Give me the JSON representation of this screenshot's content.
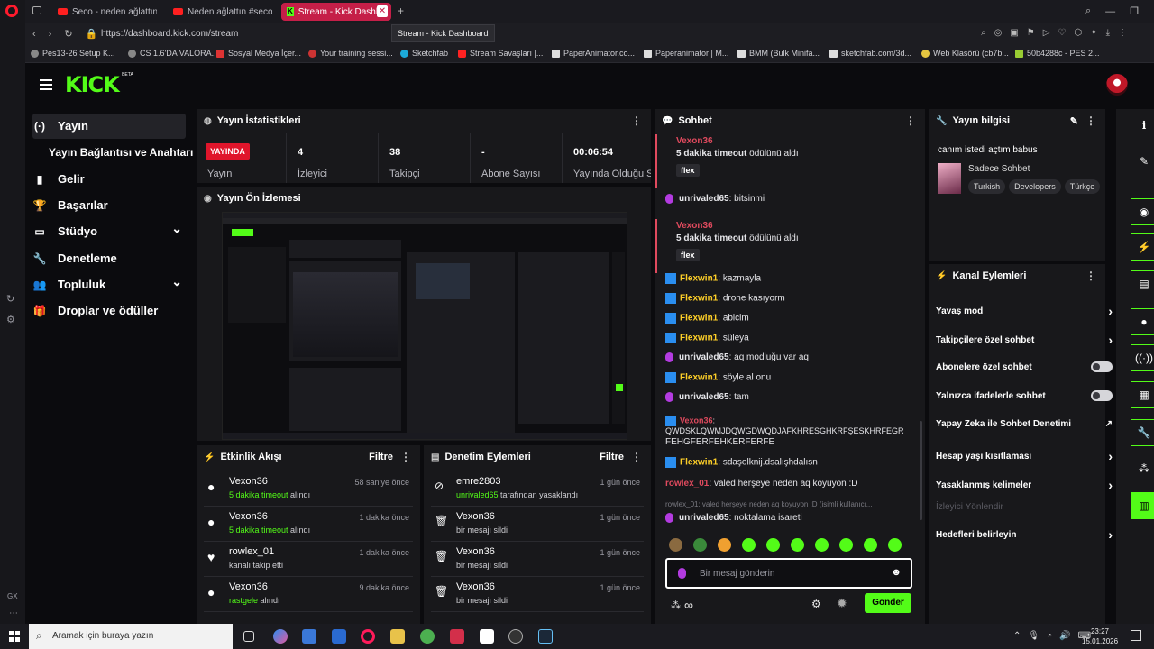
{
  "browser": {
    "tabs": [
      {
        "title": "Seco - neden ağlattın (can"
      },
      {
        "title": "Neden ağlattın #seco #tu"
      },
      {
        "title": "Stream - Kick Dashbo",
        "active": true
      }
    ],
    "url": "https://dashboard.kick.com/stream",
    "tooltip": "Stream - Kick Dashboard",
    "bookmarks": [
      "Pes13-26 Setup K...",
      "CS 1.6'DA VALORA...",
      "Sosyal Medya İçer...",
      "Your training sessi...",
      "Sketchfab",
      "Stream Savaşları |...",
      "PaperAnimator.co...",
      "Paperanimator | M...",
      "BMM (Bulk Minifa...",
      "sketchfab.com/3d...",
      "Web Klasörü (cb7b...",
      "50b4288c - PES 2..."
    ],
    "left_label": "GX"
  },
  "kick": {
    "logo": "KICK",
    "logo_beta": "BETA",
    "nav": [
      {
        "label": "Yayın",
        "icon": "(·)"
      },
      {
        "label": "Yayın Bağlantısı ve Anahtarı"
      },
      {
        "label": "Gelir",
        "icon": "▮"
      },
      {
        "label": "Başarılar",
        "icon": "🏆"
      },
      {
        "label": "Stüdyo",
        "icon": "▭",
        "chevron": "⌄"
      },
      {
        "label": "Denetleme",
        "icon": "🔧"
      },
      {
        "label": "Topluluk",
        "icon": "👥",
        "chevron": "⌄"
      },
      {
        "label": "Droplar ve ödüller",
        "icon": "🎁"
      }
    ],
    "stats": {
      "title": "Yayın İstatistikleri",
      "live_badge": "YAYINDA",
      "live_label": "Yayın",
      "items": [
        {
          "value": "4",
          "label": "İzleyici"
        },
        {
          "value": "38",
          "label": "Takipçi"
        },
        {
          "value": "-",
          "label": "Abone Sayısı"
        },
        {
          "value": "00:06:54",
          "label": "Yayında Olduğu Sü"
        }
      ]
    },
    "preview": {
      "title": "Yayın Ön İzlemesi"
    },
    "activity": {
      "title": "Etkinlik Akışı",
      "filter": "Filtre",
      "rows": [
        {
          "name": "Vexon36",
          "desc_hl": "5 dakika timeout",
          "desc": " alındı",
          "time": "58 saniye önce",
          "icon": "●"
        },
        {
          "name": "Vexon36",
          "desc_hl": "5 dakika timeout",
          "desc": " alındı",
          "time": "1 dakika önce",
          "icon": "●"
        },
        {
          "name": "rowlex_01",
          "desc_hl": "",
          "desc": "kanalı takip etti",
          "time": "1 dakika önce",
          "icon": "♥"
        },
        {
          "name": "Vexon36",
          "desc_hl": "rastgele",
          "desc": " alındı",
          "time": "9 dakika önce",
          "icon": "●"
        }
      ]
    },
    "moderation": {
      "title": "Denetim Eylemleri",
      "filter": "Filtre",
      "rows": [
        {
          "name": "emre2803",
          "desc_hl": "unrivaled65",
          "desc": " tarafından yasaklandı",
          "time": "1 gün önce",
          "icon": "⊘"
        },
        {
          "name": "Vexon36",
          "desc_hl": "",
          "desc": "bir mesajı sildi",
          "time": "1 gün önce",
          "icon": "🗑"
        },
        {
          "name": "Vexon36",
          "desc_hl": "",
          "desc": "bir mesajı sildi",
          "time": "1 gün önce",
          "icon": "🗑"
        },
        {
          "name": "Vexon36",
          "desc_hl": "",
          "desc": "bir mesajı sildi",
          "time": "1 gün önce",
          "icon": "🗑"
        }
      ]
    },
    "chat": {
      "title": "Sohbet",
      "messages": [
        {
          "user": "Vexon36",
          "text_bold": "5 dakika timeout",
          "text": " ödülünü aldı",
          "tag": "flex"
        },
        {
          "user": "unrivaled65",
          "text": "bitsinmi"
        },
        {
          "user": "Vexon36",
          "text_bold": "5 dakika timeout",
          "text": " ödülünü aldı",
          "tag": "flex"
        },
        {
          "user": "Flexwin1",
          "text": "kazmayla"
        },
        {
          "user": "Flexwin1",
          "text": "drone kasıyorm"
        },
        {
          "user": "Flexwin1",
          "text": "abicim"
        },
        {
          "user": "Flexwin1",
          "text": "süleya"
        },
        {
          "user": "unrivaled65",
          "text": "aq modluğu var aq"
        },
        {
          "user": "Flexwin1",
          "text": "söyle al onu"
        },
        {
          "user": "unrivaled65",
          "text": "tam"
        },
        {
          "user": "Vexon36",
          "text": "QWDSKLQWMJDQWGDWQDJAFKHRESGHKRFŞESKHRFEGR"
        },
        {
          "user": "",
          "text": "FEHGFERFEHKERFERFE"
        },
        {
          "user": "Flexwin1",
          "text": "sdaşolknij.dsalışhdalısn"
        },
        {
          "user": "rowlex_01",
          "text": "valed herşeye neden aq koyuyon :D"
        },
        {
          "user": "rowlex_01",
          "text": "valed herşeye neden aq koyuyon :D (isimli kullanıcı..."
        },
        {
          "user": "unrivaled65",
          "text": "noktalama isareti"
        }
      ],
      "input_placeholder": "Bir mesaj gönderin",
      "send_label": "Gönder",
      "infinity": "∞"
    },
    "stream_info": {
      "title": "Yayın bilgisi",
      "stream_title": "canım istedi açtım babus",
      "category": "Sadece Sohbet",
      "tags": [
        "Turkish",
        "Developers",
        "Türkçe"
      ]
    },
    "channel_actions": {
      "title": "Kanal Eylemleri",
      "items": [
        {
          "label": "Yavaş mod",
          "control": "chevron"
        },
        {
          "label": "Takipçilere özel sohbet",
          "control": "chevron"
        },
        {
          "label": "Abonelere özel sohbet",
          "control": "toggle"
        },
        {
          "label": "Yalnızca ifadelerle sohbet",
          "control": "toggle"
        },
        {
          "label": "Yapay Zeka ile Sohbet Denetimi",
          "control": "external"
        },
        {
          "label": "Hesap yaşı kısıtlaması",
          "control": "chevron"
        },
        {
          "label": "Yasaklanmış kelimeler",
          "control": "chevron"
        },
        {
          "label": "İzleyici Yönlendir",
          "control": "disabled"
        },
        {
          "label": "Hedefleri belirleyin",
          "control": "chevron"
        }
      ]
    }
  },
  "taskbar": {
    "search_placeholder": "Aramak için buraya yazın",
    "time": "23:27",
    "date": "15.01.2026"
  },
  "colors": {
    "accent": "#53fc18",
    "live": "#e0152b",
    "panel": "#18181b",
    "bg": "#0b0b0e"
  }
}
